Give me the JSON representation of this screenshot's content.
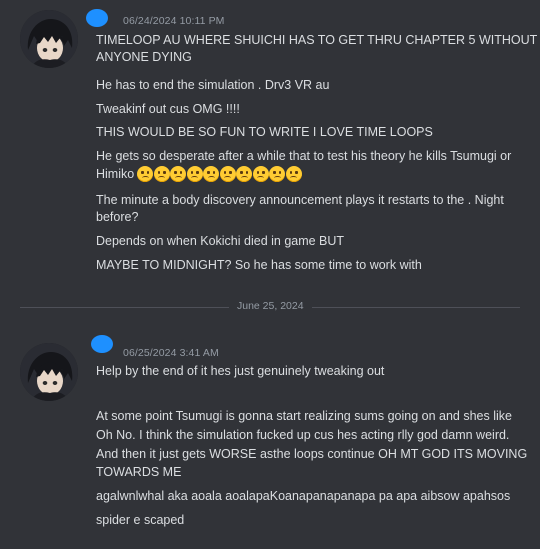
{
  "messages": [
    {
      "timestamp": "06/24/2024 10:11 PM",
      "lines": [
        "TIMELOOP AU WHERE SHUICHI HAS TO GET THRU CHAPTER 5 WITHOUT",
        "ANYONE DYING",
        "He has to end the simulation . Drv3 VR au",
        "Tweakinf out cus OMG !!!!",
        "THIS WOULD BE SO FUN TO WRITE I LOVE TIME LOOPS",
        "He gets so desperate after a while that to test his theory he kills Tsumugi or",
        "Himiko",
        "The minute a body discovery announcement plays it restarts to the  . Night",
        "before?",
        "Depends on when Kokichi died in game BUT",
        "MAYBE TO MIDNIGHT? So he has some time to work with"
      ],
      "emoji_name": "frowning-face-emoji",
      "emoji_count": 10
    },
    {
      "timestamp": "06/25/2024 3:41 AM",
      "lines": [
        "Help by the end of it hes just genuinely tweaking out",
        "At some point Tsumugi is gonna start realizing sums going on and shes like",
        "Oh No. I think the simulation fucked up cus hes acting rlly god damn weird.",
        "And then it just gets WORSE asthe loops continue OH MT GOD ITS MOVING",
        "TOWARDS ME",
        "agalwnlwhal aka aoala aoalapaKoanapanapanapa pa apa aibsow apahsos",
        "spider  e scaped"
      ]
    }
  ],
  "date_divider": "June 25, 2024",
  "colors": {
    "background": "#313338",
    "text": "#dbdee1",
    "muted": "#949ba4",
    "name_redaction": "#1e90ff",
    "emoji": "#ffcc33"
  }
}
